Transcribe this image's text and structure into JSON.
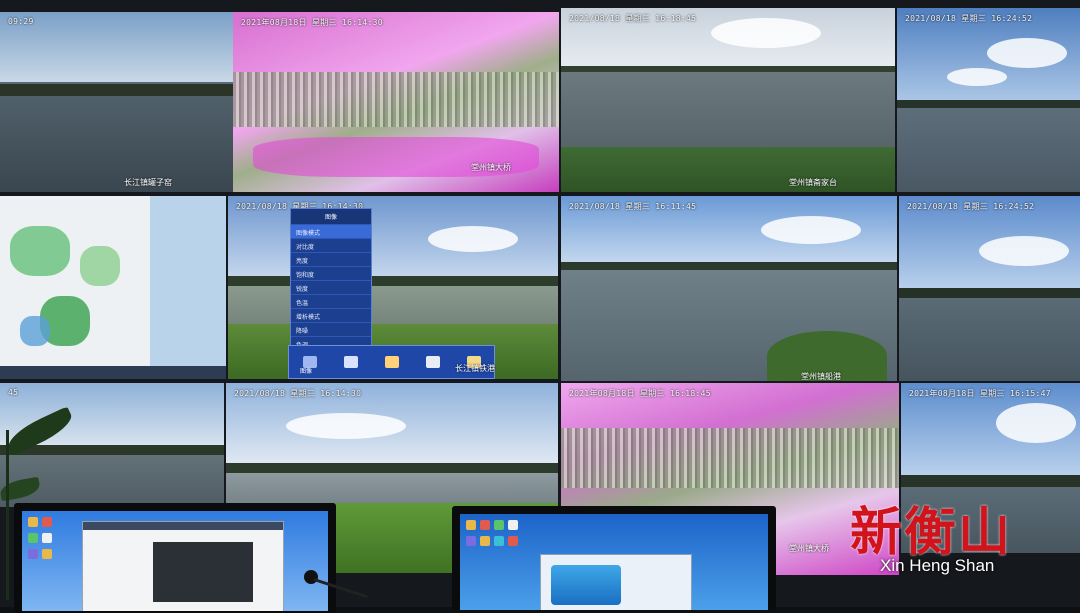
{
  "tiles": [
    {
      "id": "r1c1",
      "timestamp": "09:29",
      "label": "长江镇罐子窑"
    },
    {
      "id": "r1c2",
      "timestamp": "2021年08月18日 星期三 16:14:30",
      "label": "堂州镇大桥"
    },
    {
      "id": "r1c3",
      "timestamp": "2021/08/18 星期三 16:18:45",
      "label": "堂州镇斋家台"
    },
    {
      "id": "r1c4",
      "timestamp": "2021/08/18 星期三 16:24:52",
      "label": ""
    },
    {
      "id": "r2c2",
      "timestamp": "2021/08/18 星期三 16:14:30",
      "label": "长江镇铁港"
    },
    {
      "id": "r2c3",
      "timestamp": "2021/08/18 星期三 16:11:45",
      "label": "堂州镇船港"
    },
    {
      "id": "r2c4",
      "timestamp": "2021/08/18 星期三 16:24:52",
      "label": ""
    },
    {
      "id": "r3c1",
      "timestamp": "45",
      "label": ""
    },
    {
      "id": "r3c2",
      "timestamp": "2021/08/18 星期三 16:14:30",
      "label": ""
    },
    {
      "id": "r3c3",
      "timestamp": "2021年08月18日 星期三 16:18:45",
      "label": "堂州镇大桥"
    },
    {
      "id": "r3c4",
      "timestamp": "2021年08月18日 星期三 16:15:47",
      "label": ""
    }
  ],
  "osd_menu": {
    "title": "图像",
    "items": [
      "图像模式",
      "对比度",
      "亮度",
      "饱和度",
      "锐度",
      "色温",
      "增析模式",
      "降噪",
      "色调"
    ],
    "bar_label": "图像"
  },
  "brand": {
    "title": "新衡山",
    "subtitle": "Xin Heng Shan"
  },
  "colors": {
    "brand_red": "#d1141c",
    "osd_blue": "#1c3f8f"
  }
}
